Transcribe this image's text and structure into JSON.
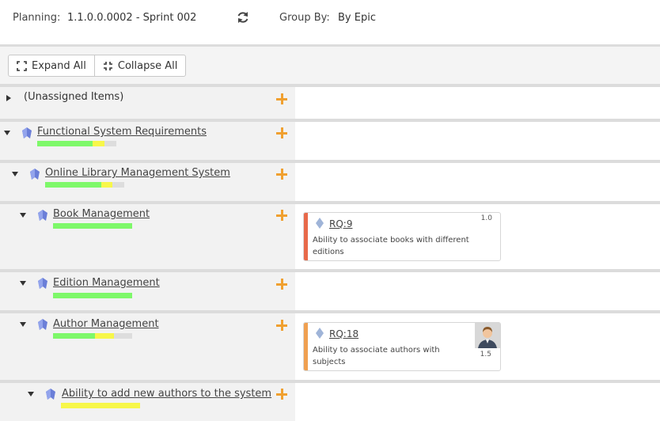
{
  "header": {
    "planning_label": "Planning:",
    "planning_value": "1.1.0.0.0002 - Sprint 002",
    "group_label": "Group By:",
    "group_value": "By Epic",
    "refresh_icon": "refresh-icon"
  },
  "toolbar": {
    "expand_label": "Expand All",
    "collapse_label": "Collapse All"
  },
  "colors": {
    "progress_done": "#7ef86a",
    "progress_partial": "#f7f74a",
    "add_icon": "#f0a030",
    "epic_icon": "#6b7fd8",
    "priority_high": "#e8694a",
    "priority_medium": "#f0a050"
  },
  "rows": [
    {
      "title": "(Unassigned Items)",
      "expanded": false
    },
    {
      "title": "Functional System Requirements",
      "expanded": true,
      "progress": {
        "done": 0.7,
        "partial": 0.15
      }
    },
    {
      "title": "Online Library Management System",
      "expanded": true,
      "progress": {
        "done": 0.71,
        "partial": 0.14
      }
    },
    {
      "title": "Book Management",
      "expanded": true,
      "progress": {
        "done": 1.0,
        "partial": 0
      }
    },
    {
      "title": "Edition Management",
      "expanded": true,
      "progress": {
        "done": 1.0,
        "partial": 0
      }
    },
    {
      "title": "Author Management",
      "expanded": true,
      "progress": {
        "done": 0.53,
        "partial": 0.24
      }
    },
    {
      "title": "Ability to add new authors to the system",
      "expanded": true,
      "progress": {
        "done": 0,
        "partial": 1.0
      }
    }
  ],
  "cards": [
    {
      "code": "RQ:9",
      "description": "Ability to associate books with different editions",
      "points": "1.0",
      "priority_color": "#e8694a",
      "has_avatar": false
    },
    {
      "code": "RQ:18",
      "description": "Ability to associate authors with subjects",
      "points": "1.5",
      "priority_color": "#f0a050",
      "has_avatar": true
    }
  ]
}
